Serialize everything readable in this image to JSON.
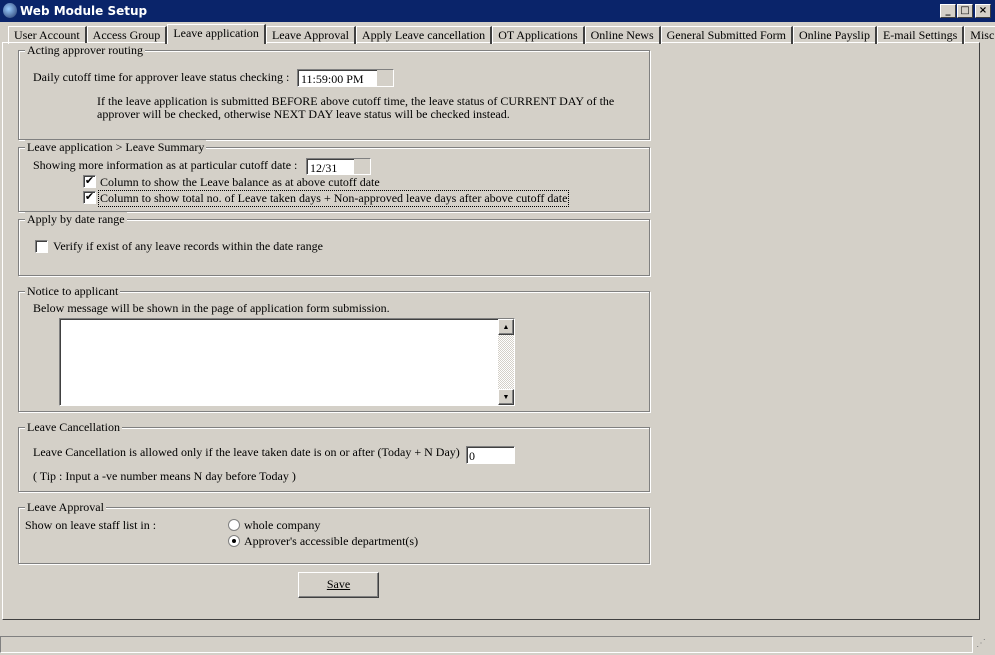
{
  "window": {
    "title": "Web Module Setup",
    "min": "_",
    "max": "□",
    "close": "×"
  },
  "tabs": [
    "User Account",
    "Access Group",
    "Leave application",
    "Leave Approval",
    "Apply Leave cancellation",
    "OT Applications",
    "Online News",
    "General Submitted Form",
    "Online Payslip",
    "E-mail Settings",
    "Misc."
  ],
  "routing": {
    "legend": "Acting approver routing",
    "label": "Daily cutoff time for approver leave status checking :",
    "time": "11:59:00 PM",
    "note1": "If the leave application is submitted BEFORE above cutoff time, the leave status of CURRENT DAY of the",
    "note2": "approver will be checked, otherwise NEXT DAY leave status will be checked instead."
  },
  "summary": {
    "legend": "Leave application > Leave Summary",
    "label": "Showing more information as at particular cutoff date :",
    "date": "12/31",
    "cb1": "Column to show the Leave balance as at above cutoff date",
    "cb2": "Column to show total no. of Leave taken days + Non-approved leave days after above cutoff date",
    "check": "✔"
  },
  "daterange": {
    "legend": "Apply by date range",
    "cb": "Verify if exist of any leave records within the date range"
  },
  "notice": {
    "legend": "Notice to applicant",
    "label": "Below message will be shown in the page of application form submission.",
    "message": ""
  },
  "cancellation": {
    "legend": "Leave Cancellation",
    "label": "Leave Cancellation is allowed only if the leave taken date is on or after (Today + N Day)",
    "value": "0",
    "tip": "( Tip : Input a -ve number means N day before Today )"
  },
  "approval": {
    "legend": "Leave Approval",
    "label": "Show on leave staff list in :",
    "opt1": "whole company",
    "opt2": "Approver's accessible department(s)"
  },
  "save": "Save"
}
